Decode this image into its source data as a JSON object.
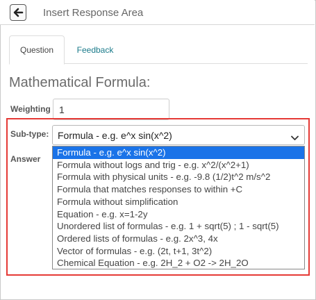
{
  "window": {
    "title": "Insert Response Area",
    "back_icon": "back-arrow-icon"
  },
  "tabs": [
    {
      "label": "Question",
      "active": true
    },
    {
      "label": "Feedback",
      "active": false
    }
  ],
  "section_heading": "Mathematical Formula:",
  "form": {
    "weighting_label": "Weighting",
    "weighting_value": "1",
    "subtype_label": "Sub-type:",
    "subtype_selected": "Formula - e.g. e^x sin(x^2)",
    "answer_label": "Answer"
  },
  "dropdown_options": [
    "Formula - e.g. e^x sin(x^2)",
    "Formula without logs and trig - e.g. x^2/(x^2+1)",
    "Formula with physical units - e.g. -9.8 (1/2)t^2 m/s^2",
    "Formula that matches responses to within +C",
    "Formula without simplification",
    "Equation - e.g. x=1-2y",
    "Unordered list of formulas - e.g. 1 + sqrt(5) ; 1 - sqrt(5)",
    "Ordered lists of formulas - e.g. 2x^3, 4x",
    "Vector of formulas - e.g. (2t, t+1, 3t^2)",
    "Chemical Equation - e.g. 2H_2 + O2 -> 2H_2O"
  ],
  "colors": {
    "highlight_box": "#e53935",
    "selected_option_bg": "#1a73e8",
    "feedback_tab_text": "#1a7a8a"
  }
}
